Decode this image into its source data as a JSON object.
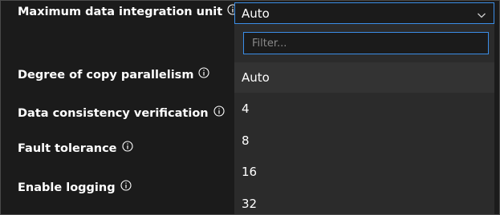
{
  "settings": [
    {
      "label": "Maximum data integration unit"
    },
    {
      "label": "Degree of copy parallelism"
    },
    {
      "label": "Data consistency verification"
    },
    {
      "label": "Fault tolerance"
    },
    {
      "label": "Enable logging"
    }
  ],
  "select": {
    "value": "Auto",
    "filter_placeholder": "Filter...",
    "options": [
      "Auto",
      "4",
      "8",
      "16",
      "32"
    ]
  },
  "colors": {
    "accent": "#3b8ee8",
    "background": "#1b1b1b",
    "dropdown_bg": "#2b2b2b"
  }
}
